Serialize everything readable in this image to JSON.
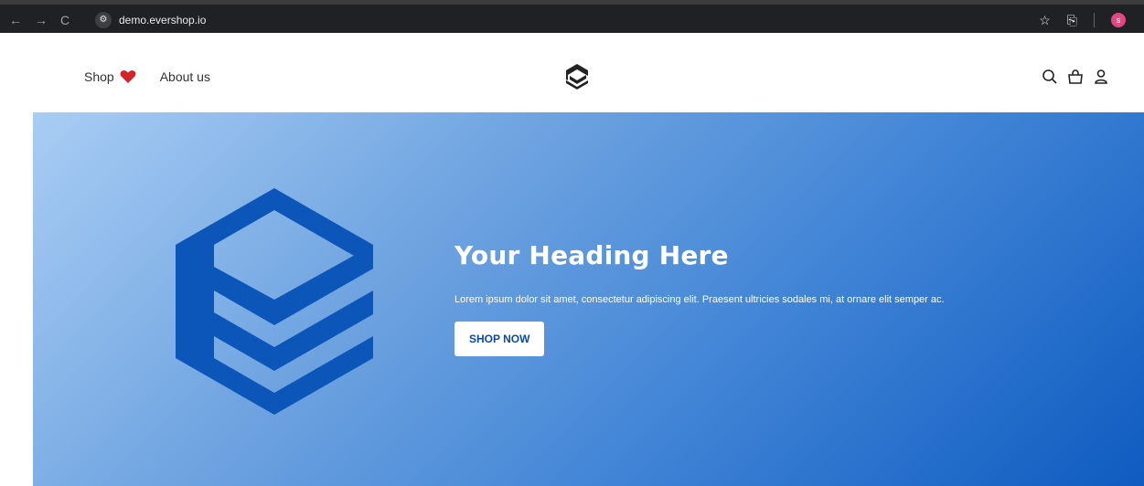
{
  "browser": {
    "url": "demo.evershop.io",
    "icons": {
      "back": "←",
      "forward": "→",
      "reload": "C",
      "site_settings": "⚙",
      "bookmark": "☆",
      "extensions": "⎘"
    },
    "avatar_letter": "s"
  },
  "header": {
    "menu": [
      {
        "label": "Shop",
        "icon": "heart-icon"
      },
      {
        "label": "About us"
      }
    ],
    "icons": [
      "search-icon",
      "shopping-bag-icon",
      "user-icon"
    ]
  },
  "hero": {
    "title": "Your Heading Here",
    "description": "Lorem ipsum dolor sit amet, consectetur adipiscing elit. Praesent ultricies sodales mi, at ornare elit semper ac.",
    "button_label": "SHOP NOW"
  },
  "colors": {
    "hero_gradient_start": "#a9cdf4",
    "hero_gradient_end": "#0e5bc0",
    "brand_blue": "#0b56b8",
    "heart_red": "#d5232a"
  }
}
